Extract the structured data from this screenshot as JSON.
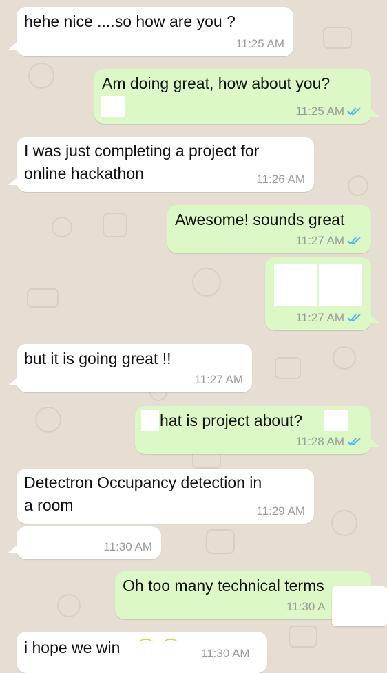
{
  "messages": [
    {
      "text": "hehe nice ....so how are you ?",
      "time": "11:25 AM"
    },
    {
      "text": "Am doing great, how about you?",
      "time": "11:25 AM"
    },
    {
      "line1": "I was just completing a project for",
      "line2": "online hackathon",
      "time": "11:26 AM"
    },
    {
      "text": "Awesome! sounds great",
      "time": "11:27 AM"
    },
    {
      "text": "",
      "time": "11:27 AM"
    },
    {
      "text": "but it is going great !!",
      "time": "11:27 AM"
    },
    {
      "text": "hat is project about?",
      "time": "11:28 AM"
    },
    {
      "line1": "Detectron Occupancy detection in",
      "line2": "a room",
      "time": "11:29 AM"
    },
    {
      "text": "",
      "time": "11:30 AM"
    },
    {
      "text": "Oh too many technical terms",
      "time": "11:30 A"
    },
    {
      "text": "i hope we win",
      "time": "11:30 AM"
    }
  ],
  "colors": {
    "background": "#e7ded3",
    "incoming_bubble": "#ffffff",
    "outgoing_bubble": "#dcf8c6",
    "read_ticks": "#4fb6ec",
    "timestamp": "#9a9a9a"
  },
  "icons": {
    "read_receipt": "double-check-icon"
  }
}
